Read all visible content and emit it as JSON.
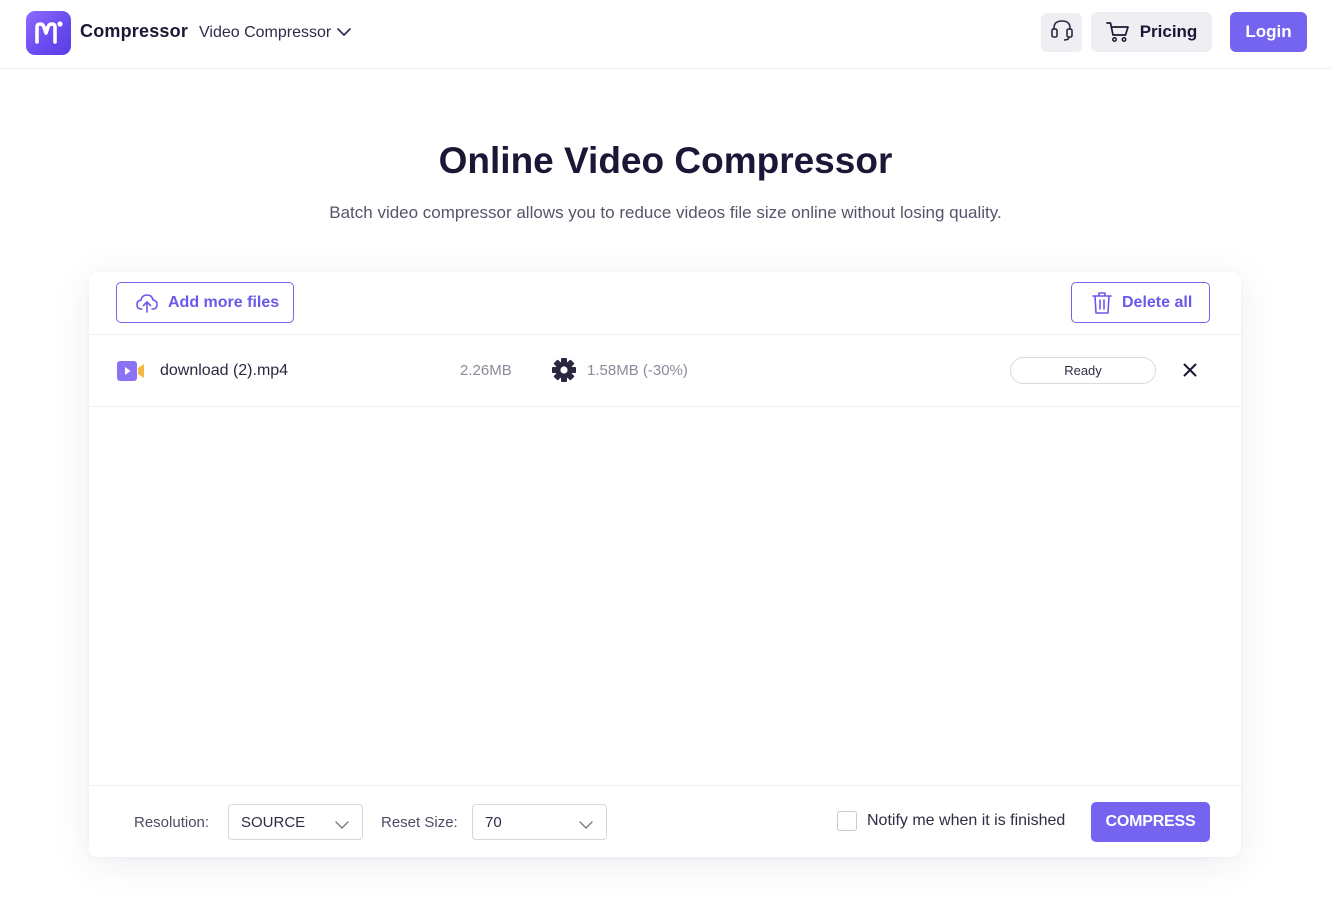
{
  "header": {
    "brand": "Compressor",
    "nav_menu_label": "Video Compressor",
    "pricing_label": "Pricing",
    "login_label": "Login"
  },
  "hero": {
    "title": "Online Video Compressor",
    "subtitle": "Batch video compressor allows you to reduce videos file size online without losing quality."
  },
  "toolbar": {
    "add_files_label": "Add more files",
    "delete_all_label": "Delete all"
  },
  "files": [
    {
      "name": "download (2).mp4",
      "original_size": "2.26MB",
      "compressed_size": "1.58MB (-30%)",
      "status": "Ready"
    }
  ],
  "footer": {
    "resolution_label": "Resolution:",
    "resolution_value": "SOURCE",
    "reset_size_label": "Reset Size:",
    "reset_size_value": "70",
    "notify_label": "Notify me when it is finished",
    "notify_checked": false,
    "compress_label": "COMPRESS"
  },
  "icons": {
    "logo": "brand-logo-icon",
    "nav_chevron": "chevron-down-icon",
    "support": "headset-icon",
    "cart": "cart-icon",
    "upload": "cloud-upload-icon",
    "trash": "trash-icon",
    "video_file": "video-file-icon",
    "settings": "gear-icon",
    "remove": "close-icon"
  },
  "colors": {
    "accent": "#7564f0",
    "logo_gradient_start": "#8f6bff",
    "logo_gradient_end": "#5a3ce6",
    "title_text": "#1a1836",
    "muted_text": "#8b8a99",
    "video_icon_purple": "#8b72f5",
    "video_icon_yellow": "#f4b740"
  }
}
